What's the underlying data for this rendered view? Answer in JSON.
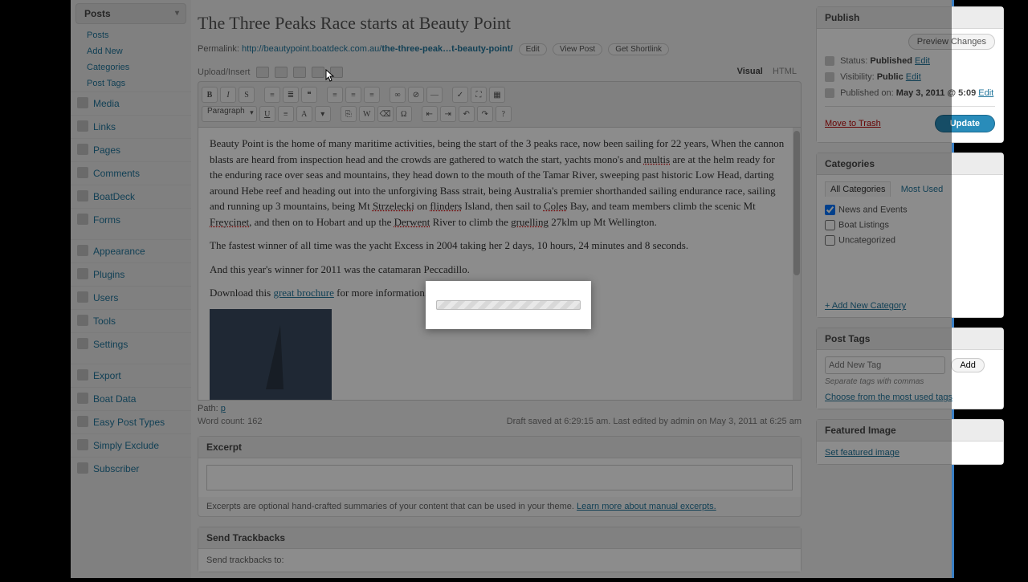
{
  "sidebar": {
    "active_section": "Posts",
    "sub": [
      "Posts",
      "Add New",
      "Categories",
      "Post Tags"
    ],
    "items": [
      "Media",
      "Links",
      "Pages",
      "Comments",
      "BoatDeck",
      "Forms",
      "Appearance",
      "Plugins",
      "Users",
      "Tools",
      "Settings",
      "Export",
      "Boat Data",
      "Easy Post Types",
      "Simply Exclude",
      "Subscriber"
    ]
  },
  "post": {
    "title": "The Three Peaks Race starts at Beauty Point",
    "permalink_label": "Permalink:",
    "permalink_base": "http://beautypoint.boatdeck.com.au/",
    "permalink_slug": "the-three-peak…t-beauty-point/",
    "btn_edit": "Edit",
    "btn_view": "View Post",
    "btn_shortlink": "Get Shortlink",
    "upload_label": "Upload/Insert",
    "tab_visual": "Visual",
    "tab_html": "HTML",
    "format_select": "Paragraph",
    "body": {
      "p1_a": "Beauty Point is the home of many maritime activities, being the start of the 3 peaks race, now been sailing for 22 years, When the cannon blasts are heard from inspection head and the crowds are gathered to watch the start, yachts mono's and ",
      "p1_u1": "multis",
      "p1_b": " are at the helm ready for the enduring race over seas and mountains, they head down to the mouth of the Tamar River, sweeping past  historic Low Head, darting around Hebe reef and heading out into the unforgiving Bass strait, being Australia's premier shorthanded sailing endurance race, sailing and running up  3 mountains, being Mt ",
      "p1_u2": "Strzelecki",
      "p1_c": " on ",
      "p1_u3": "flinders",
      "p1_d": " Island, then sail to ",
      "p1_u4": "Coles",
      "p1_e": " Bay, and team members climb the scenic Mt ",
      "p1_u5": "Freycinet",
      "p1_f": ", and then on to Hobart and up the ",
      "p1_u6": "Derwent",
      "p1_g": " River to climb the ",
      "p1_u7": "gruelling",
      "p1_h": " 27klm up Mt Wellington.",
      "p2": "The fastest winner of all time was the yacht Excess in 2004 taking her 2 days, 10 hours, 24 minutes and 8 seconds.",
      "p3": "And this year's winner for 2011 was the catamaran Peccadillo.",
      "p4_a": "Download this ",
      "p4_link": "great brochure",
      "p4_b": " for more information."
    },
    "path_label": "Path:",
    "path_val": "p",
    "word_count_label": "Word count:",
    "word_count": "162",
    "draft_saved": "Draft saved at 6:29:15 am. Last edited by admin on May 3, 2011 at 6:25 am"
  },
  "excerpt": {
    "title": "Excerpt",
    "note_a": "Excerpts are optional hand-crafted summaries of your content that can be used in your theme. ",
    "note_link": "Learn more about manual excerpts."
  },
  "trackbacks": {
    "title": "Send Trackbacks",
    "label": "Send trackbacks to:"
  },
  "publish": {
    "title": "Publish",
    "preview": "Preview Changes",
    "status_label": "Status:",
    "status_val": "Published",
    "vis_label": "Visibility:",
    "vis_val": "Public",
    "pub_label": "Published on:",
    "pub_val": "May 3, 2011 @ 5:09",
    "edit": "Edit",
    "trash": "Move to Trash",
    "update": "Update"
  },
  "categories": {
    "title": "Categories",
    "tab_all": "All Categories",
    "tab_most": "Most Used",
    "items": [
      {
        "label": "News and Events",
        "checked": true
      },
      {
        "label": "Boat Listings",
        "checked": false
      },
      {
        "label": "Uncategorized",
        "checked": false
      }
    ],
    "add": "+ Add New Category"
  },
  "tags": {
    "title": "Post Tags",
    "placeholder": "Add New Tag",
    "add": "Add",
    "hint": "Separate tags with commas",
    "choose": "Choose from the most used tags"
  },
  "featured": {
    "title": "Featured Image",
    "set": "Set featured image"
  }
}
